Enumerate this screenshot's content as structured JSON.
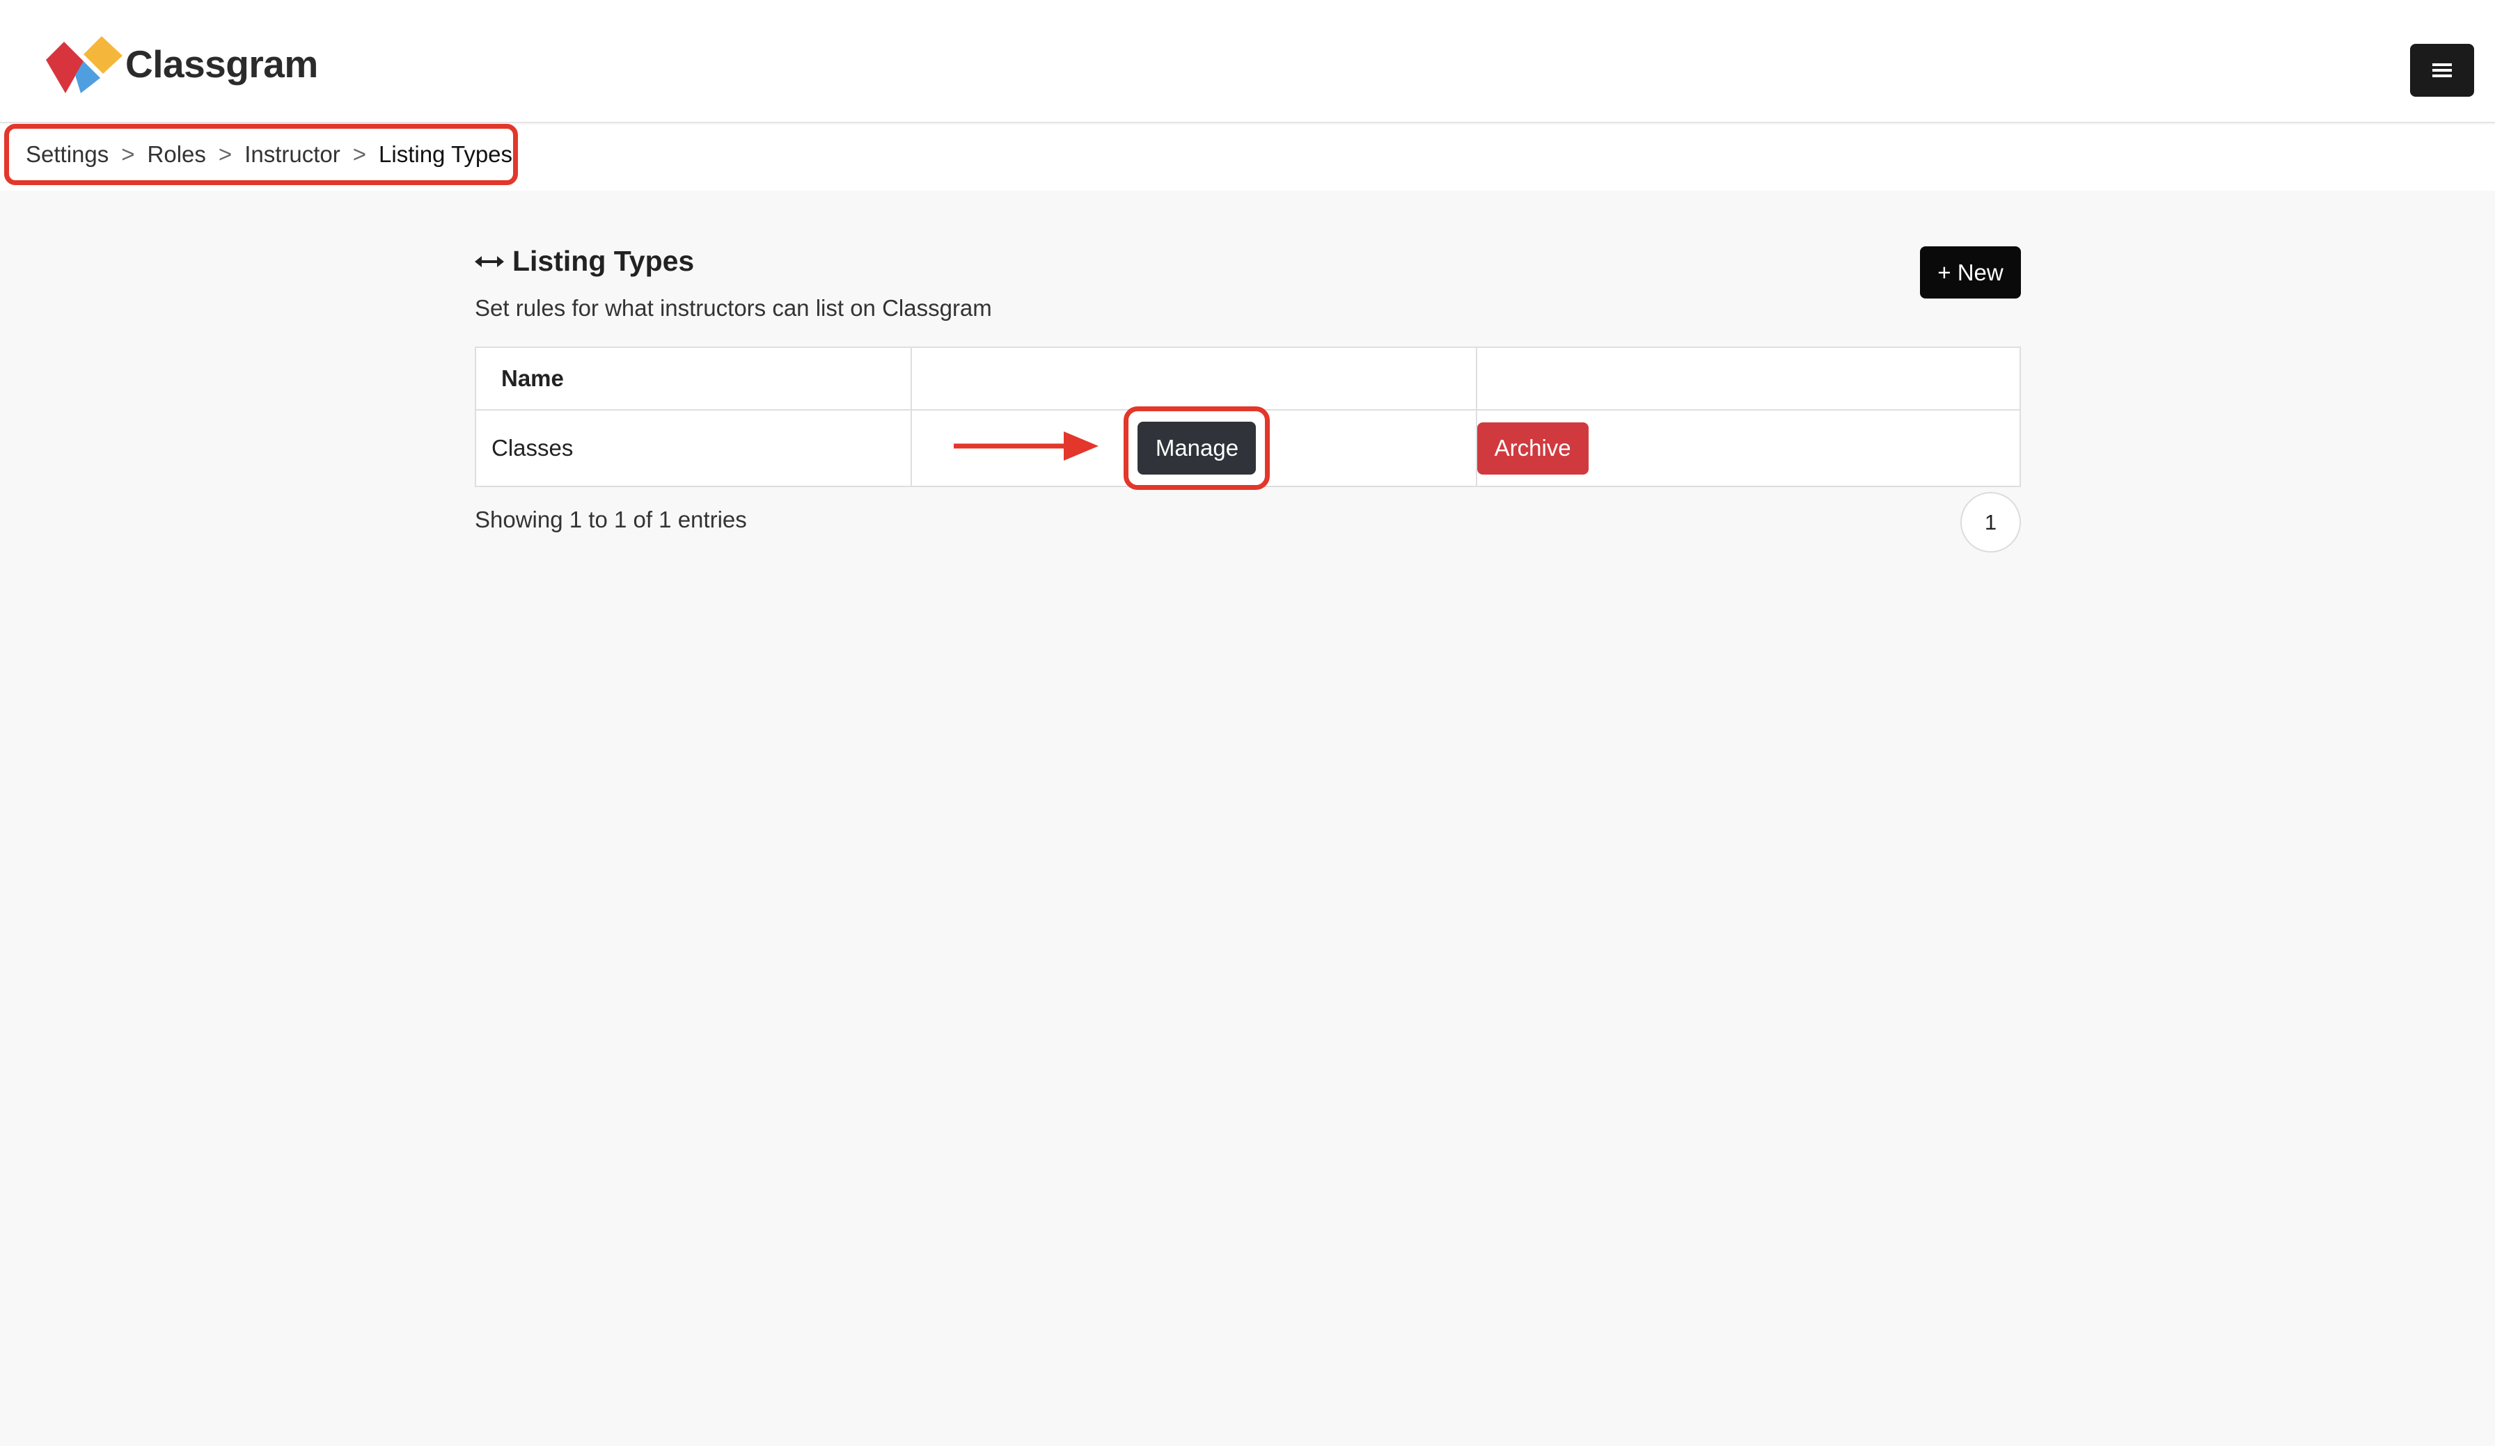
{
  "app": {
    "brand": "Classgram",
    "logo_icon": "classgram-logo-icon",
    "menu_icon": "hamburger-menu-icon"
  },
  "breadcrumb": {
    "items": [
      "Settings",
      "Roles",
      "Instructor",
      "Listing Types"
    ],
    "separator": ">"
  },
  "page": {
    "title_icon": "horizontal-arrows-icon",
    "title": "Listing Types",
    "subtitle": "Set rules for what instructors can list on Classgram",
    "new_button": "+ New"
  },
  "table": {
    "columns": [
      "Name",
      "",
      ""
    ],
    "rows": [
      {
        "name": "Classes",
        "manage_label": "Manage",
        "archive_label": "Archive"
      }
    ]
  },
  "footer": {
    "entries_text": "Showing 1 to 1 of 1 entries",
    "pages": [
      "1"
    ]
  },
  "colors": {
    "highlight": "#e2372a",
    "archive": "#d03a3f",
    "manage": "#30343a",
    "new_button": "#0a0a0a"
  }
}
